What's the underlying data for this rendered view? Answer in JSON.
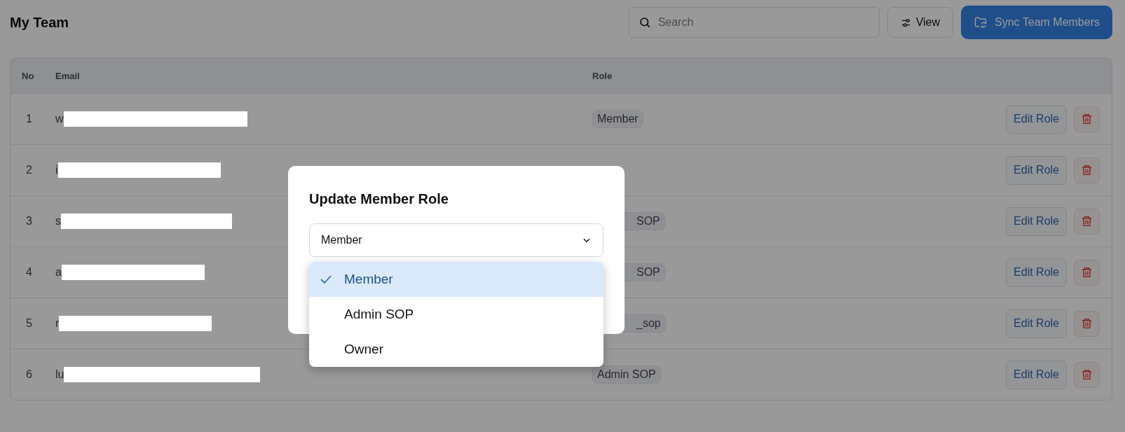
{
  "page": {
    "title": "My Team"
  },
  "toolbar": {
    "search": {
      "placeholder": "Search"
    },
    "view_button": "View",
    "sync_button": "Sync Team Members"
  },
  "table": {
    "columns": [
      "No",
      "Email",
      "Role"
    ],
    "rows": [
      {
        "no": "1",
        "email": "w",
        "role": "Member",
        "role_partial": false,
        "action": "Edit Role"
      },
      {
        "no": "2",
        "email": "i",
        "action": "Edit Role"
      },
      {
        "no": "3",
        "email": "s",
        "role": "SOP",
        "role_partial": true,
        "action": "Edit Role"
      },
      {
        "no": "4",
        "email": "a",
        "role": "SOP",
        "role_partial": true,
        "action": "Edit Role"
      },
      {
        "no": "5",
        "email": "r",
        "role": "_sop",
        "role_partial": true,
        "action": "Edit Role"
      },
      {
        "no": "6",
        "email": "lu",
        "role": "Admin SOP",
        "role_partial": false,
        "action": "Edit Role"
      }
    ]
  },
  "dialog": {
    "title": "Update Member Role",
    "select": {
      "value": "Member",
      "options": [
        {
          "label": "Member",
          "selected": true
        },
        {
          "label": "Admin SOP",
          "selected": false
        },
        {
          "label": "Owner",
          "selected": false
        }
      ]
    }
  }
}
